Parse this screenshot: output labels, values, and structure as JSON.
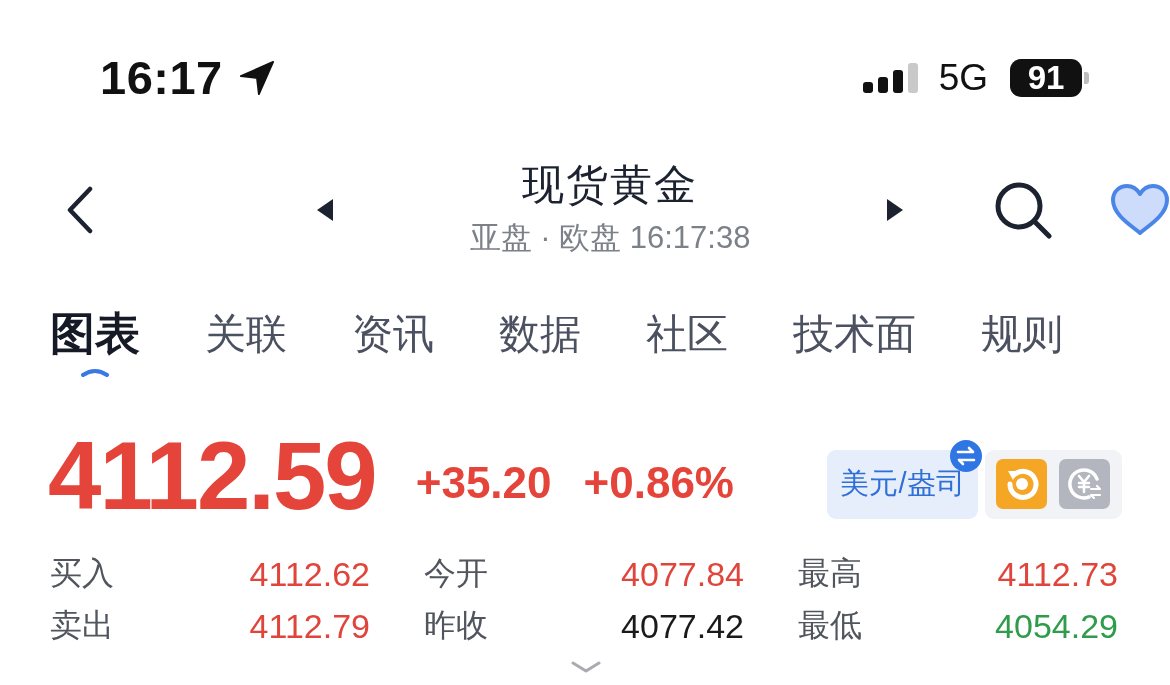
{
  "status_bar": {
    "time": "16:17",
    "network": "5G",
    "battery": "91"
  },
  "header": {
    "title": "现货黄金",
    "subtitle": "亚盘 · 欧盘 16:17:38"
  },
  "tabs": [
    {
      "label": "图表",
      "selected": true
    },
    {
      "label": "关联",
      "selected": false
    },
    {
      "label": "资讯",
      "selected": false
    },
    {
      "label": "数据",
      "selected": false
    },
    {
      "label": "社区",
      "selected": false
    },
    {
      "label": "技术面",
      "selected": false
    },
    {
      "label": "规则",
      "selected": false
    }
  ],
  "quote": {
    "price": "4112.59",
    "change": "+35.20",
    "change_percent": "+0.86%",
    "color": "#e5443a",
    "unit": "美元/盎司"
  },
  "stats": [
    {
      "label": "买入",
      "value": "4112.62",
      "color": "#e0453c"
    },
    {
      "label": "今开",
      "value": "4077.84",
      "color": "#e0453c"
    },
    {
      "label": "最高",
      "value": "4112.73",
      "color": "#e0453c"
    },
    {
      "label": "卖出",
      "value": "4112.79",
      "color": "#e0453c"
    },
    {
      "label": "昨收",
      "value": "4077.42",
      "color": "#1a1a1a"
    },
    {
      "label": "最低",
      "value": "4054.29",
      "color": "#2e9c4a"
    }
  ]
}
